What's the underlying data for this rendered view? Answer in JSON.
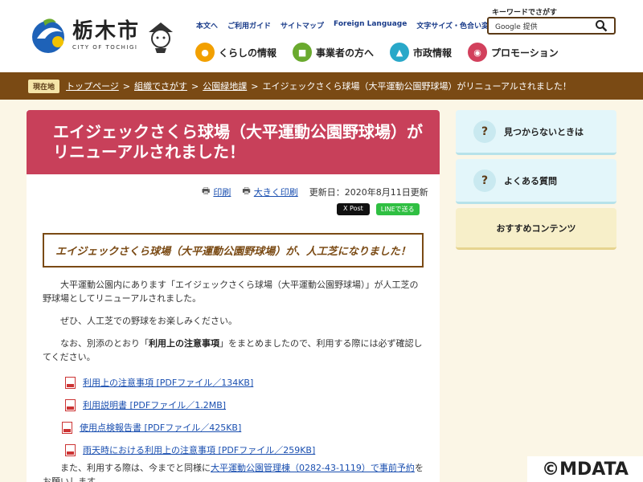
{
  "header": {
    "logo_text": "栃木市",
    "logo_sub": "CITY OF TOCHIGI",
    "utility_links": [
      "本文へ",
      "ご利用ガイド",
      "サイトマップ",
      "Foreign Language",
      "文字サイズ・色合い変更"
    ],
    "search_label": "キーワードでさがす",
    "search_placeholder": "Google 提供",
    "nav": [
      {
        "label": "くらしの情報",
        "icon": "family-icon",
        "color": "#f2a000"
      },
      {
        "label": "事業者の方へ",
        "icon": "briefcase-icon",
        "color": "#6aaa2e"
      },
      {
        "label": "市政情報",
        "icon": "people-icon",
        "color": "#29a8c9"
      },
      {
        "label": "プロモーション",
        "icon": "broadcast-icon",
        "color": "#d2405c"
      }
    ]
  },
  "breadcrumb": {
    "here_label": "現在地",
    "items": [
      "トップページ",
      "組織でさがす",
      "公園緑地課"
    ],
    "current": "エイジェックさくら球場（大平運動公園野球場）がリニューアルされました！"
  },
  "article": {
    "title": "エイジェックさくら球場（大平運動公園野球場）がリニューアルされました！",
    "print_label": "印刷",
    "print_large_label": "大きく印刷",
    "updated": "更新日：2020年8月11日更新",
    "x_post": "X Post",
    "line_share": "LINEで送る",
    "subheading": "エイジェックさくら球場（大平運動公園野球場）が、人工芝になりました！",
    "p1": "大平運動公園内にあります「エイジェックさくら球場（大平運動公園野球場）」が人工芝の野球場としてリニューアルされました。",
    "p2": "ぜひ、人工芝での野球をお楽しみください。",
    "p3_before": "なお、別添のとおり「",
    "p3_bold": "利用上の注意事項",
    "p3_after": "」をまとめましたので、利用する際には必ず確認してください。",
    "files": [
      "利用上の注意事項 [PDFファイル／134KB]",
      "利用説明書 [PDFファイル／1.2MB]",
      "使用点検報告書 [PDFファイル／425KB]",
      "雨天時における利用上の注意事項 [PDFファイル／259KB]"
    ],
    "p4_before": "また、利用する際は、今までと同様に",
    "p4_link": "大平運動公園管理棟（0282-43-1119）で事前予約",
    "p4_after": "をお願いします。"
  },
  "sidebar": [
    {
      "label": "見つからないときは",
      "icon": "search-question-icon"
    },
    {
      "label": "よくある質問",
      "icon": "faq-icon"
    },
    {
      "label": "おすすめコンテンツ"
    }
  ],
  "watermark": "©MDATA",
  "colors": {
    "brown": "#7a4a14",
    "title_bg": "#c8405a",
    "link": "#1a4fb0",
    "page_bg": "#fbf6e6"
  }
}
